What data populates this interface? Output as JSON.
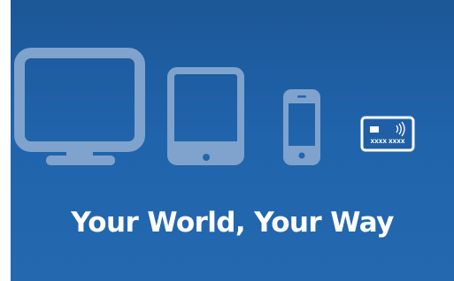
{
  "slide": {
    "tagline": "Your World, Your Way"
  },
  "devices": {
    "items": [
      {
        "icon": "desktop-monitor-icon"
      },
      {
        "icon": "tablet-icon"
      },
      {
        "icon": "smartphone-icon"
      },
      {
        "icon": "contactless-card-icon"
      }
    ],
    "card_number": "XXXX XXXX"
  },
  "colors": {
    "background_top": "#1c5797",
    "background_bottom": "#2468b0",
    "device_outline": "#7fa3cd",
    "card_outline": "#ffffff",
    "text": "#ffffff"
  }
}
